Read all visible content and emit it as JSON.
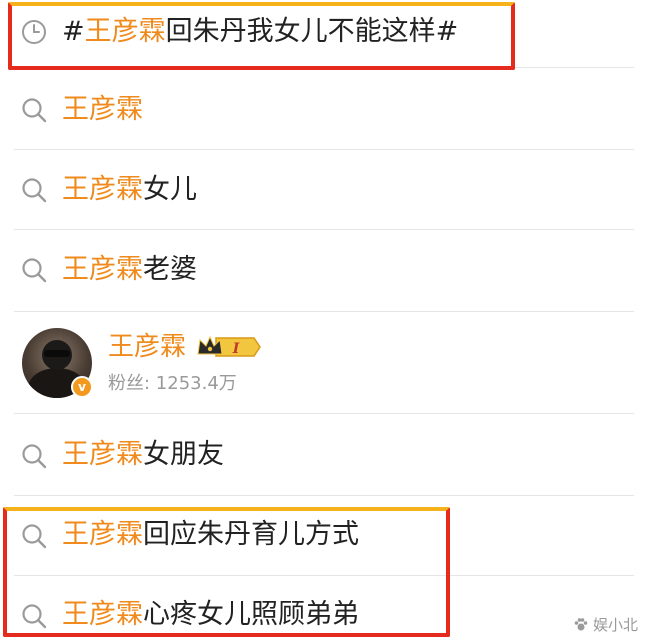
{
  "history_item": {
    "hash_open": "#",
    "highlight": "王彦霖",
    "rest": "回朱丹我女儿不能这样",
    "hash_close": "#"
  },
  "suggestions": [
    {
      "highlight": "王彦霖",
      "rest": ""
    },
    {
      "highlight": "王彦霖",
      "rest": "女儿"
    },
    {
      "highlight": "王彦霖",
      "rest": "老婆"
    }
  ],
  "user_card": {
    "name": "王彦霖",
    "level": "I",
    "fans": "粉丝: 1253.4万",
    "verified_mark": "v"
  },
  "suggestions_after": [
    {
      "highlight": "王彦霖",
      "rest": "女朋友"
    },
    {
      "highlight": "王彦霖",
      "rest": "回应朱丹育儿方式"
    },
    {
      "highlight": "王彦霖",
      "rest": "心疼女儿照顾弟弟"
    }
  ],
  "watermark": "娱小北",
  "colors": {
    "highlight": "#f08a1c",
    "box_red": "#e52b1e",
    "box_orange": "#f6b21a"
  }
}
